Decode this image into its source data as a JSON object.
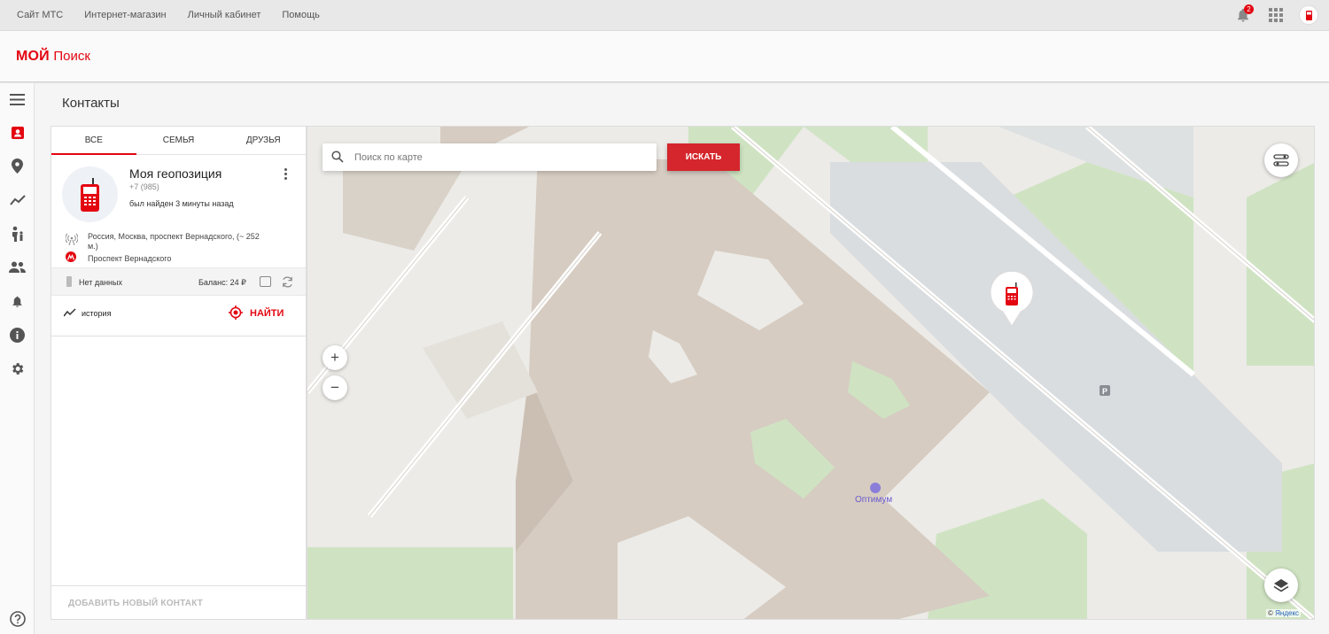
{
  "topbar": {
    "links": [
      "Сайт МТС",
      "Интернет-магазин",
      "Личный кабинет",
      "Помощь"
    ],
    "notification_count": "2"
  },
  "brand": {
    "logo_bold": "МОЙ",
    "logo_regular": "Поиск"
  },
  "sidebar": {
    "items": [
      "menu-icon",
      "contacts-icon",
      "location-icon",
      "history-icon",
      "child-icon",
      "friends-icon",
      "notifications-icon",
      "info-icon",
      "settings-icon",
      "help-icon"
    ]
  },
  "page": {
    "title": "Контакты"
  },
  "tabs": [
    {
      "label": "ВСЕ",
      "active": true
    },
    {
      "label": "СЕМЬЯ",
      "active": false
    },
    {
      "label": "ДРУЗЬЯ",
      "active": false
    }
  ],
  "contact": {
    "name": "Моя геопозиция",
    "phone": "+7 (985)",
    "found": "был найден 3 минуты назад",
    "address": "Россия, Москва, проспект Вернадского, (~ 252 м.)",
    "metro": "Проспект Вернадского",
    "battery": "Нет данных",
    "balance": "Баланс: 24 ₽",
    "history_label": "история",
    "find_label": "НАЙТИ"
  },
  "add_contact": {
    "label": "ДОБАВИТЬ НОВЫЙ КОНТАКТ"
  },
  "map": {
    "search_placeholder": "Поиск по карте",
    "search_button": "ИСКАТЬ",
    "zoom_in": "+",
    "zoom_out": "−",
    "poi_label": "Оптимум",
    "parking": "P",
    "copyright_prefix": "©",
    "copyright_brand": "Яндекс"
  },
  "colors": {
    "accent": "#e30611",
    "button": "#d4262c"
  }
}
